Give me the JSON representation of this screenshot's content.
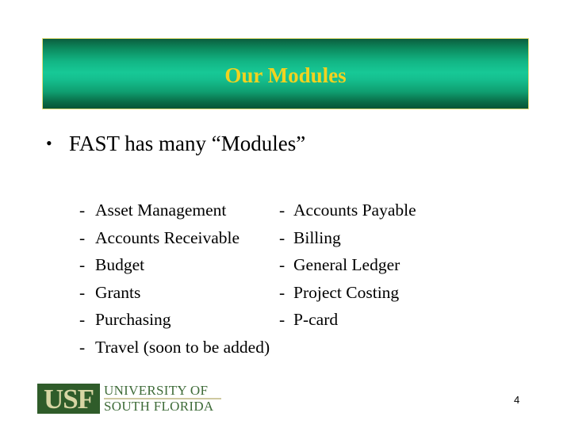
{
  "slide": {
    "title": "Our Modules",
    "bullet": {
      "symbol": "•",
      "text": "FAST has many “Modules”"
    },
    "dash_symbol": "-",
    "modules_left": [
      "Asset Management",
      "Accounts Receivable",
      "Budget",
      "Grants",
      "Purchasing",
      "Travel (soon to be added)"
    ],
    "modules_right": [
      "Accounts Payable",
      "Billing",
      "General Ledger",
      "Project Costing",
      "P-card"
    ],
    "page_number": "4"
  },
  "logo": {
    "mark": "USF",
    "line1": "UNIVERSITY OF",
    "line2": "SOUTH FLORIDA"
  },
  "colors": {
    "banner_title": "#f2d21f",
    "banner_green": "#17c896",
    "banner_border": "#e8e07a",
    "logo_green": "#2f5c2a",
    "logo_tan": "#d8d6a4"
  }
}
